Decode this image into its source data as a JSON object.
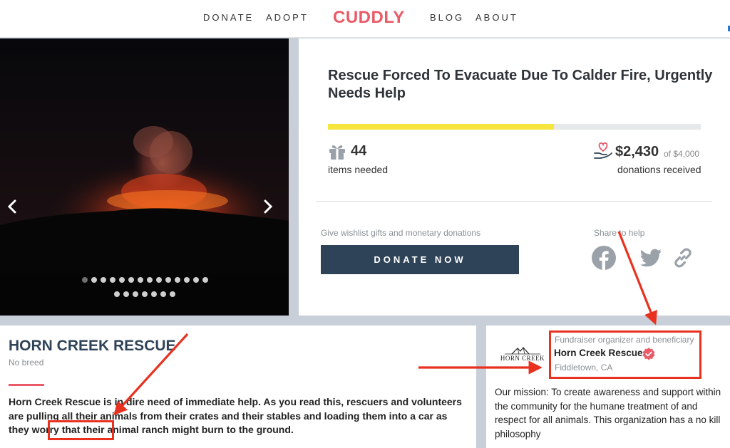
{
  "nav": {
    "donate": "DONATE",
    "adopt": "ADOPT",
    "logo": "CUDDLY",
    "blog": "BLOG",
    "about": "ABOUT"
  },
  "carousel": {
    "prev_icon": "chevron-left-icon",
    "next_icon": "chevron-right-icon",
    "dots_row1": 14,
    "dots_row2": 7,
    "active_dot": 0
  },
  "campaign": {
    "title": "Rescue Forced To Evacuate Due To Calder Fire, Urgently Needs Help",
    "progress_fraction": 0.607,
    "items_count": "44",
    "items_label": "items needed",
    "amount_raised": "$2,430",
    "amount_goal": "of $4,000",
    "donations_label": "donations received",
    "give_text": "Give wishlist gifts and monetary donations",
    "donate_button": "DONATE NOW",
    "share_text": "Share to help"
  },
  "rescue": {
    "name": "HORN CREEK RESCUE",
    "breed": "No breed",
    "description": "Horn Creek Rescue is in dire need of immediate help. As you read this, rescuers and volunteers are pulling all their animals from their crates and their stables and loading them into a car as they worry that their animal ranch might burn to the ground."
  },
  "organizer": {
    "logo_text": "HORN CREEK",
    "role": "Fundraiser organizer and beneficiary",
    "name": "Horn Creek Rescue",
    "location": "Fiddletown,  CA",
    "mission": "Our mission: To create awareness and support within the community for the humane treatment of and respect for all animals. This organization has a no kill philosophy"
  },
  "colors": {
    "brand": "#ea5a67",
    "button": "#2f4358",
    "progress": "#f5e53d",
    "annotation": "#e8321f"
  }
}
